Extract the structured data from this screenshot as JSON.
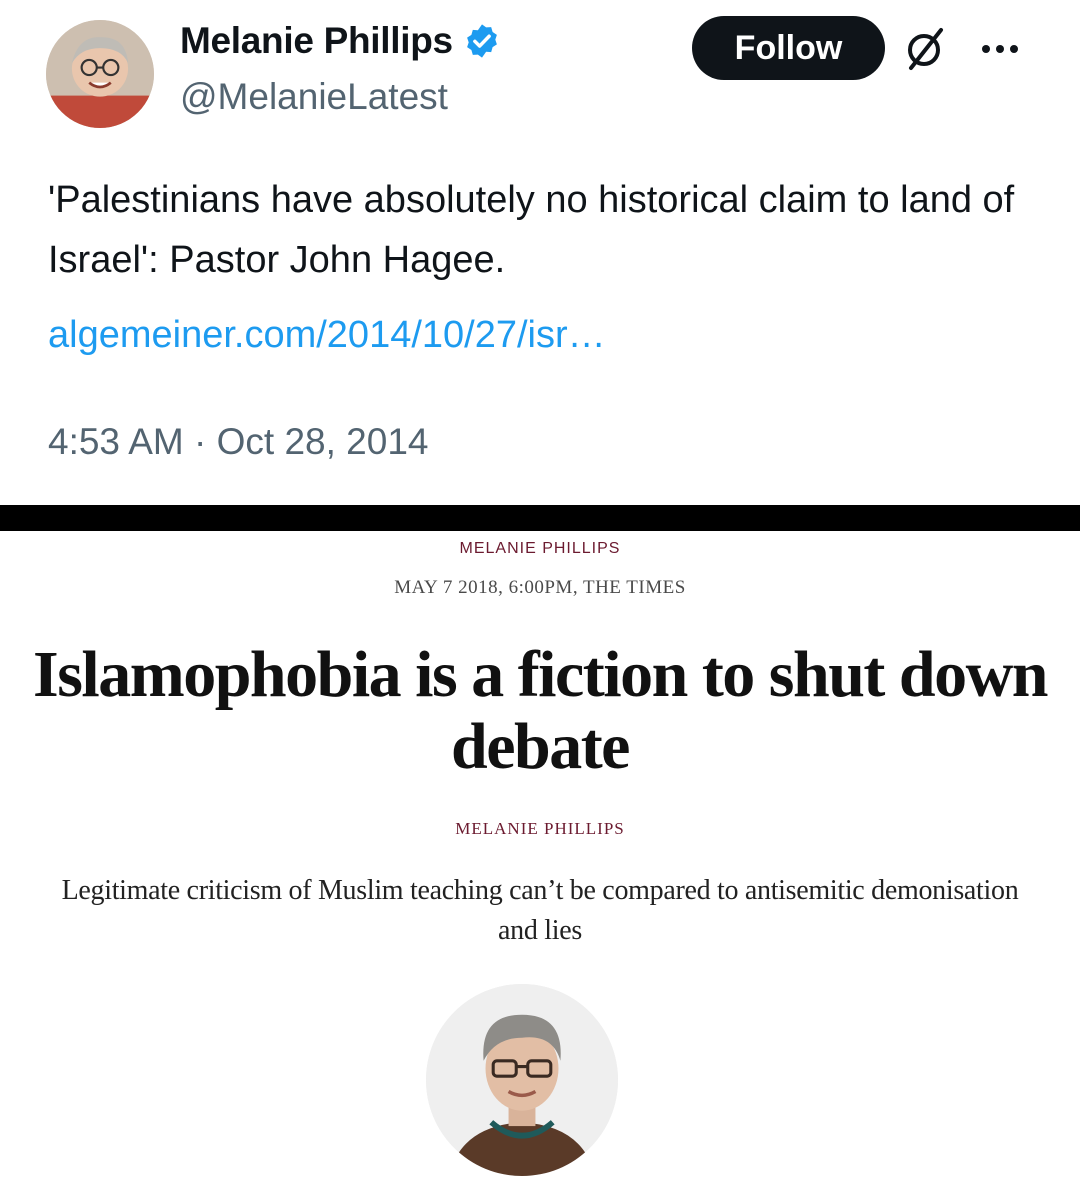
{
  "tweet": {
    "display_name": "Melanie Phillips",
    "handle": "@MelanieLatest",
    "follow_label": "Follow",
    "text": "'Palestinians have absolutely no historical claim to land of Israel': Pastor John Hagee.",
    "link": "algemeiner.com/2014/10/27/isr…",
    "timestamp": "4:53 AM · Oct 28, 2014",
    "icons": [
      "verified-badge-icon",
      "grok-icon",
      "more-icon"
    ],
    "colors": {
      "link": "#1d9bf0",
      "verified": "#1d9bf0",
      "follow_bg": "#0f1419"
    }
  },
  "article": {
    "kicker": "MELANIE PHILLIPS",
    "dateline": "MAY 7 2018, 6:00PM, THE TIMES",
    "headline": "Islamophobia is a fiction to shut down debate",
    "byline": "MELANIE PHILLIPS",
    "standfirst": "Legitimate criticism of Muslim teaching can’t be compared to antisemitic demonisation and lies",
    "colors": {
      "kicker": "#6b1a2f"
    }
  }
}
